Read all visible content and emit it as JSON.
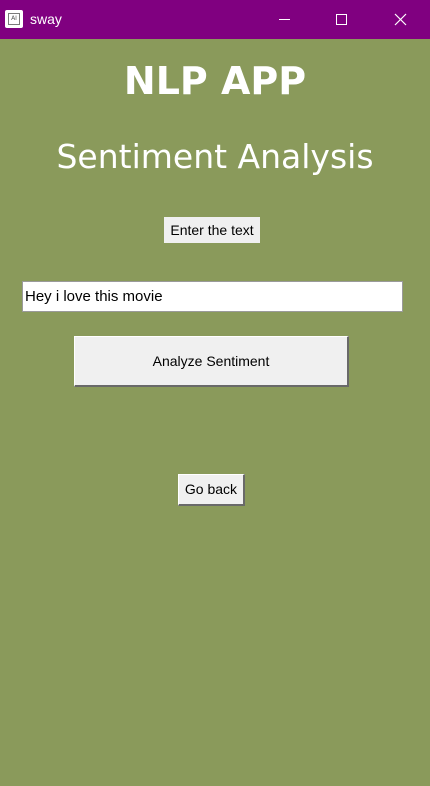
{
  "window": {
    "title": "sway",
    "app_icon": "tk-feather-icon",
    "controls": [
      "minimize-icon",
      "maximize-icon",
      "close-icon"
    ]
  },
  "main": {
    "app_title": "NLP APP",
    "subtitle": "Sentiment Analysis",
    "label": "Enter the text",
    "input_value": "Hey i love this movie",
    "analyze_button": "Analyze Sentiment",
    "back_button": "Go back"
  },
  "colors": {
    "background": "#8a9a5b",
    "titlebar": "#800080",
    "button": "#f0f0f0",
    "heading_text": "#ffffff"
  }
}
